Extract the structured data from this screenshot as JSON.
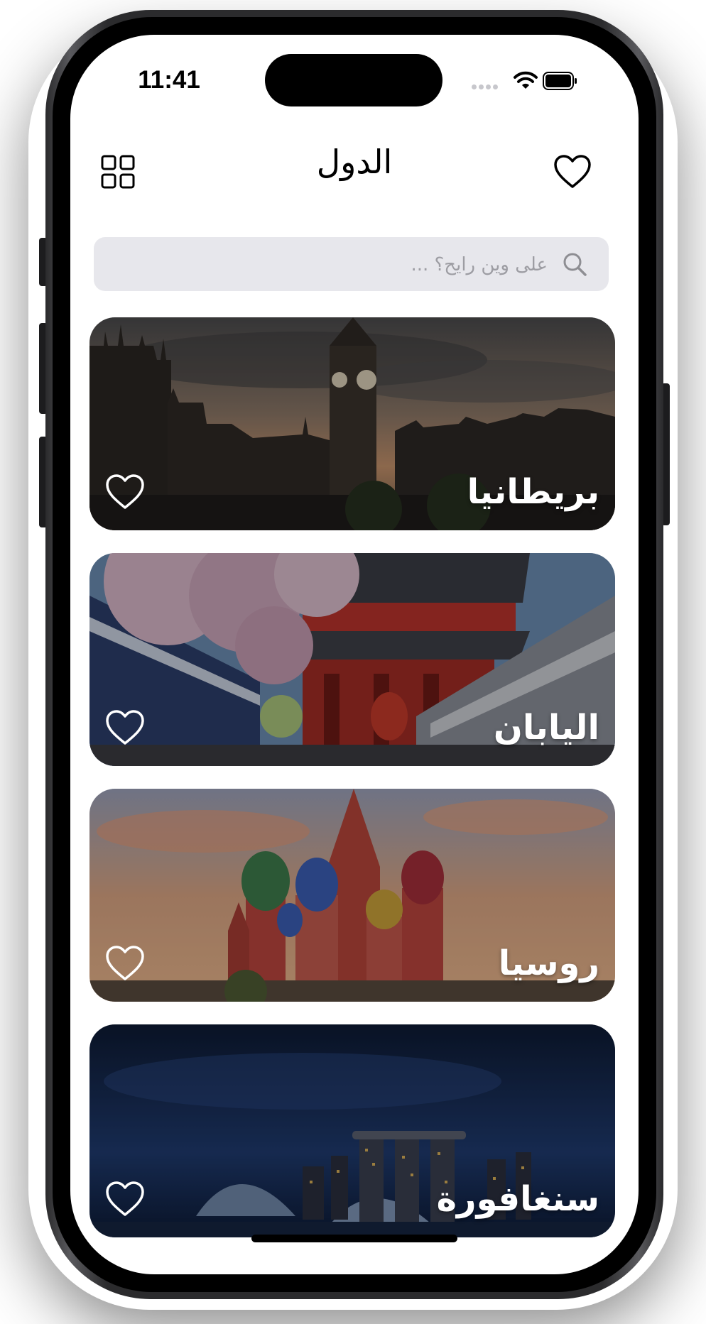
{
  "status_bar": {
    "time": "11:41"
  },
  "nav": {
    "title": "الدول"
  },
  "search": {
    "placeholder": "على وين رايح؟ ..."
  },
  "countries": [
    {
      "name": "بريطانيا"
    },
    {
      "name": "اليابان"
    },
    {
      "name": "روسيا"
    },
    {
      "name": "سنغافورة"
    }
  ],
  "colors": {
    "accent": "#000000",
    "search_bg": "#e7e7ec",
    "placeholder": "#9d9da3",
    "card_text": "#ffffff"
  },
  "icons": [
    "grid-icon",
    "heart-icon",
    "search-icon",
    "wifi-icon",
    "battery-icon"
  ]
}
